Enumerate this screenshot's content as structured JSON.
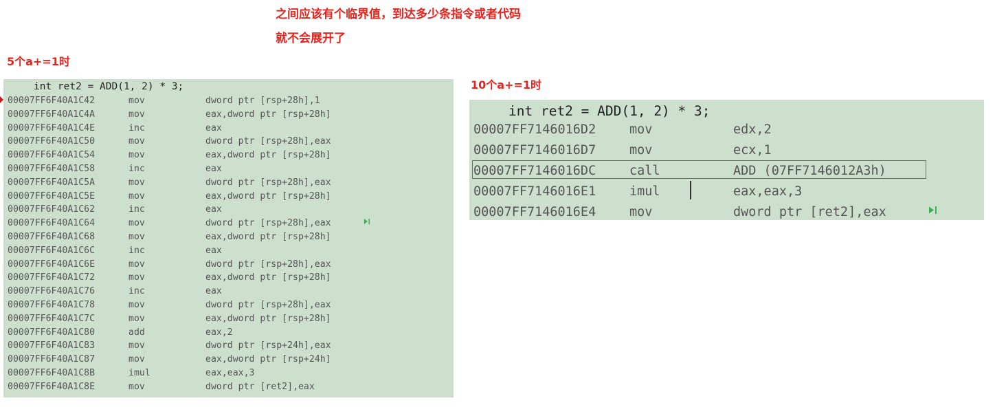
{
  "annotations": {
    "note_line1": "之间应该有个临界值，到达多少条指令或者代码",
    "note_line2": "就不会展开了",
    "label_left": "5个a+=1时",
    "label_right": "10个a+=1时",
    "accent_color": "#e8231d"
  },
  "left_panel": {
    "source_line": "int ret2 = ADD(1, 2) * 3;",
    "rows": [
      {
        "addr": "00007FF6F40A1C42",
        "mn": "mov",
        "op": "dword ptr [rsp+28h],1"
      },
      {
        "addr": "00007FF6F40A1C4A",
        "mn": "mov",
        "op": "eax,dword ptr [rsp+28h]"
      },
      {
        "addr": "00007FF6F40A1C4E",
        "mn": "inc",
        "op": "eax"
      },
      {
        "addr": "00007FF6F40A1C50",
        "mn": "mov",
        "op": "dword ptr [rsp+28h],eax"
      },
      {
        "addr": "00007FF6F40A1C54",
        "mn": "mov",
        "op": "eax,dword ptr [rsp+28h]"
      },
      {
        "addr": "00007FF6F40A1C58",
        "mn": "inc",
        "op": "eax"
      },
      {
        "addr": "00007FF6F40A1C5A",
        "mn": "mov",
        "op": "dword ptr [rsp+28h],eax"
      },
      {
        "addr": "00007FF6F40A1C5E",
        "mn": "mov",
        "op": "eax,dword ptr [rsp+28h]"
      },
      {
        "addr": "00007FF6F40A1C62",
        "mn": "inc",
        "op": "eax"
      },
      {
        "addr": "00007FF6F40A1C64",
        "mn": "mov",
        "op": "dword ptr [rsp+28h],eax"
      },
      {
        "addr": "00007FF6F40A1C68",
        "mn": "mov",
        "op": "eax,dword ptr [rsp+28h]"
      },
      {
        "addr": "00007FF6F40A1C6C",
        "mn": "inc",
        "op": "eax"
      },
      {
        "addr": "00007FF6F40A1C6E",
        "mn": "mov",
        "op": "dword ptr [rsp+28h],eax"
      },
      {
        "addr": "00007FF6F40A1C72",
        "mn": "mov",
        "op": "eax,dword ptr [rsp+28h]"
      },
      {
        "addr": "00007FF6F40A1C76",
        "mn": "inc",
        "op": "eax"
      },
      {
        "addr": "00007FF6F40A1C78",
        "mn": "mov",
        "op": "dword ptr [rsp+28h],eax"
      },
      {
        "addr": "00007FF6F40A1C7C",
        "mn": "mov",
        "op": "eax,dword ptr [rsp+28h]"
      },
      {
        "addr": "00007FF6F40A1C80",
        "mn": "add",
        "op": "eax,2"
      },
      {
        "addr": "00007FF6F40A1C83",
        "mn": "mov",
        "op": "dword ptr [rsp+24h],eax"
      },
      {
        "addr": "00007FF6F40A1C87",
        "mn": "mov",
        "op": "eax,dword ptr [rsp+24h]"
      },
      {
        "addr": "00007FF6F40A1C8B",
        "mn": "imul",
        "op": "eax,eax,3"
      },
      {
        "addr": "00007FF6F40A1C8E",
        "mn": "mov",
        "op": "dword ptr [ret2],eax"
      }
    ]
  },
  "right_panel": {
    "source_line": "int ret2 = ADD(1, 2) * 3;",
    "rows": [
      {
        "addr": "00007FF7146016D2",
        "mn": "mov",
        "op": "edx,2"
      },
      {
        "addr": "00007FF7146016D7",
        "mn": "mov",
        "op": "ecx,1"
      },
      {
        "addr": "00007FF7146016DC",
        "mn": "call",
        "op": "ADD (07FF7146012A3h)"
      },
      {
        "addr": "00007FF7146016E1",
        "mn": "imul",
        "op": "eax,eax,3"
      },
      {
        "addr": "00007FF7146016E4",
        "mn": "mov",
        "op": "dword ptr [ret2],eax"
      }
    ]
  },
  "icons": {
    "breakpoint_marker": "current-instruction-arrow-icon",
    "step_marker": "run-to-cursor-icon"
  }
}
